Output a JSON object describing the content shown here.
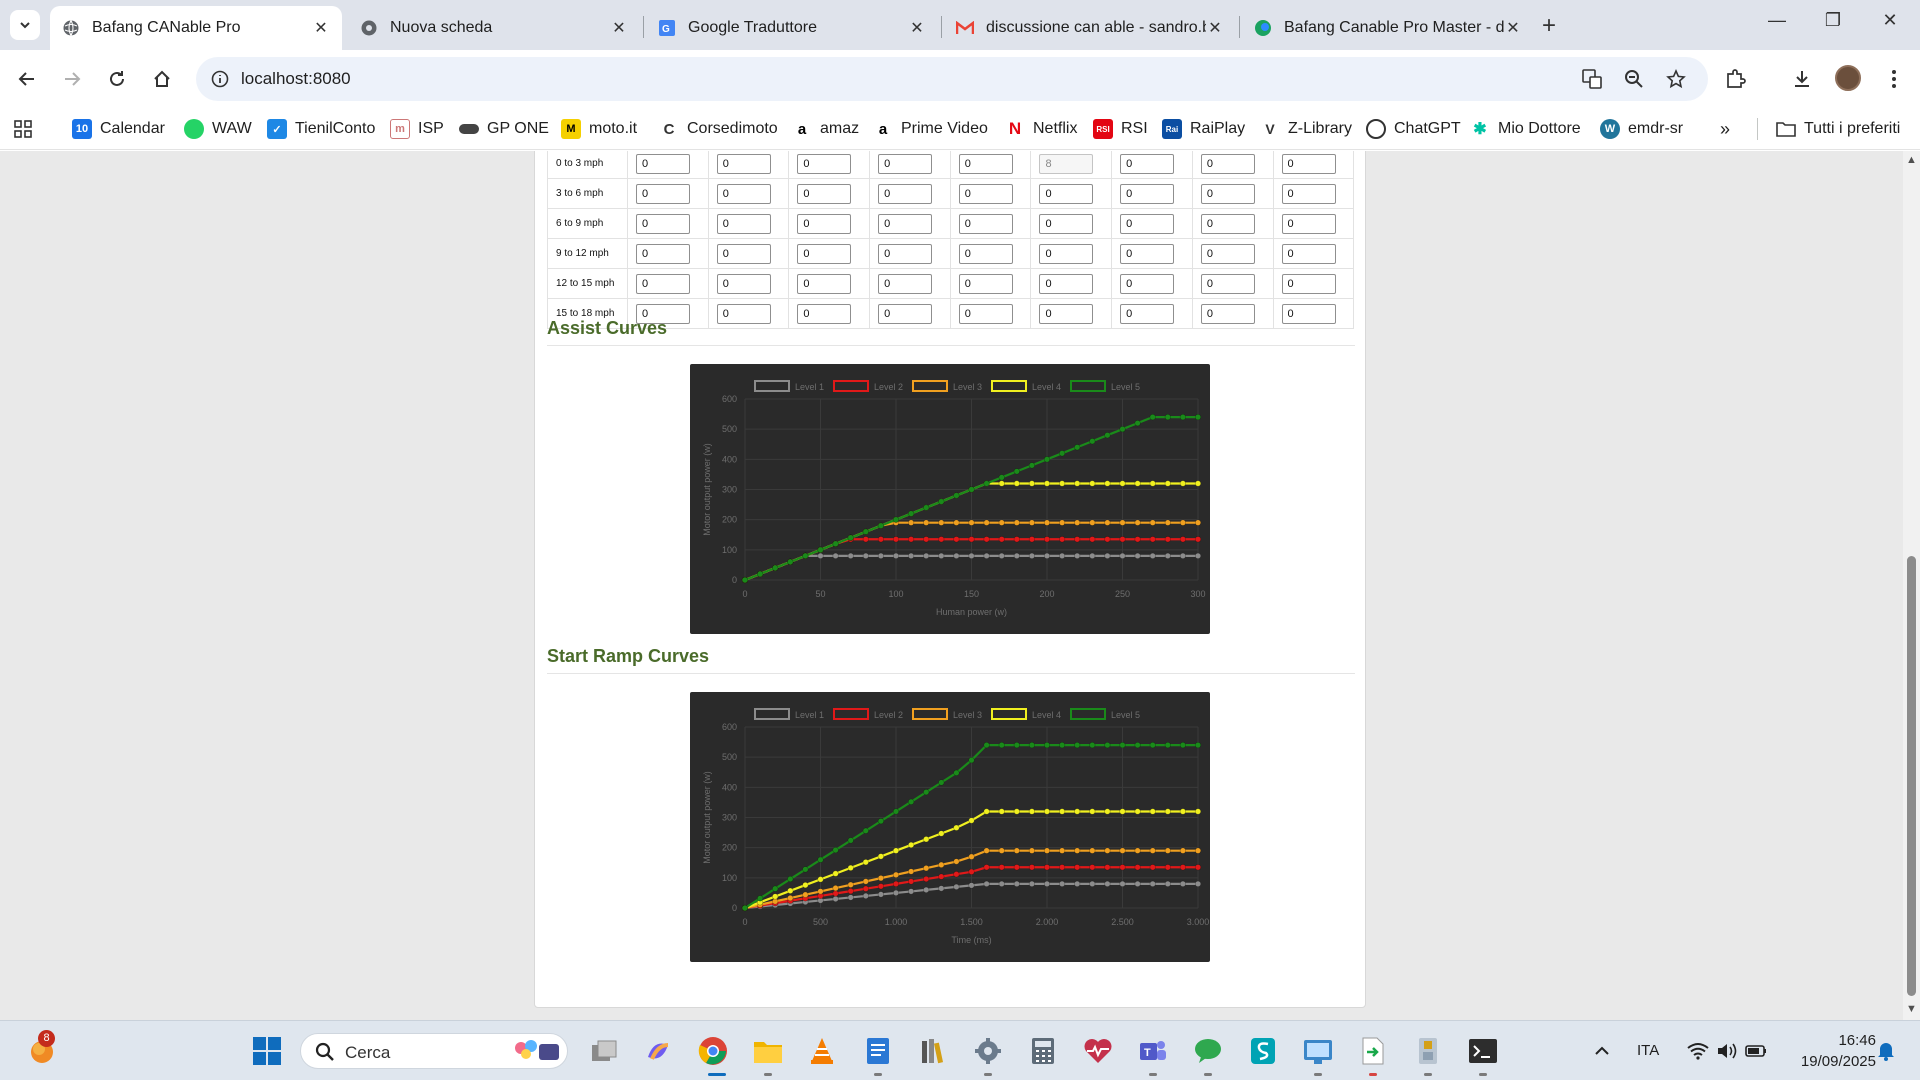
{
  "browser": {
    "tabs": [
      {
        "title": "Bafang CANable Pro",
        "active": true
      },
      {
        "title": "Nuova scheda",
        "active": false
      },
      {
        "title": "Google Traduttore",
        "active": false
      },
      {
        "title": "discussione can able - sandro.b",
        "active": false
      },
      {
        "title": "Bafang Canable Pro Master - di",
        "active": false
      }
    ],
    "url": "localhost:8080",
    "bookmarks": [
      "Calendar",
      "WAW",
      "TienilConto",
      "ISP",
      "GP ONE",
      "moto.it",
      "Corsedimoto",
      "amaz",
      "Prime Video",
      "Netflix",
      "RSI",
      "RaiPlay",
      "Z-Library",
      "ChatGPT",
      "Mio Dottore",
      "emdr-sr"
    ],
    "all_bookmarks": "Tutti i preferiti",
    "calendar_day": "10"
  },
  "table": {
    "rows": [
      {
        "label": "0 to 3 mph",
        "values": [
          "0",
          "0",
          "0",
          "0",
          "0",
          "8",
          "0",
          "0",
          "0"
        ]
      },
      {
        "label": "3 to 6 mph",
        "values": [
          "0",
          "0",
          "0",
          "0",
          "0",
          "0",
          "0",
          "0",
          "0"
        ]
      },
      {
        "label": "6 to 9 mph",
        "values": [
          "0",
          "0",
          "0",
          "0",
          "0",
          "0",
          "0",
          "0",
          "0"
        ]
      },
      {
        "label": "9 to 12 mph",
        "values": [
          "0",
          "0",
          "0",
          "0",
          "0",
          "0",
          "0",
          "0",
          "0"
        ]
      },
      {
        "label": "12 to 15 mph",
        "values": [
          "0",
          "0",
          "0",
          "0",
          "0",
          "0",
          "0",
          "0",
          "0"
        ]
      },
      {
        "label": "15 to 18 mph",
        "values": [
          "0",
          "0",
          "0",
          "0",
          "0",
          "0",
          "0",
          "0",
          "0"
        ]
      }
    ]
  },
  "sections": {
    "assist": "Assist Curves",
    "ramp": "Start Ramp Curves"
  },
  "chart_data": [
    {
      "type": "line",
      "xlabel": "Human power (w)",
      "ylabel": "Motor output power (w)",
      "xlim": [
        0,
        300
      ],
      "ylim": [
        0,
        600
      ],
      "xticks": [
        "0",
        "50",
        "100",
        "150",
        "200",
        "250",
        "300"
      ],
      "yticks": [
        "0",
        "100",
        "200",
        "300",
        "400",
        "500",
        "600"
      ],
      "x": [
        0,
        10,
        20,
        30,
        40,
        50,
        60,
        70,
        80,
        90,
        100,
        110,
        120,
        130,
        140,
        150,
        160,
        170,
        180,
        190,
        200,
        210,
        220,
        230,
        240,
        250,
        260,
        270,
        280,
        290,
        300
      ],
      "legend_position": "top",
      "grid": true,
      "series": [
        {
          "name": "Level 1",
          "color": "#8c8c8c",
          "values": [
            0,
            20,
            40,
            60,
            80,
            80,
            80,
            80,
            80,
            80,
            80,
            80,
            80,
            80,
            80,
            80,
            80,
            80,
            80,
            80,
            80,
            80,
            80,
            80,
            80,
            80,
            80,
            80,
            80,
            80,
            80
          ]
        },
        {
          "name": "Level 2",
          "color": "#e01919",
          "values": [
            0,
            20,
            40,
            60,
            80,
            100,
            120,
            135,
            135,
            135,
            135,
            135,
            135,
            135,
            135,
            135,
            135,
            135,
            135,
            135,
            135,
            135,
            135,
            135,
            135,
            135,
            135,
            135,
            135,
            135,
            135
          ]
        },
        {
          "name": "Level 3",
          "color": "#f0a020",
          "values": [
            0,
            20,
            40,
            60,
            80,
            100,
            120,
            140,
            160,
            180,
            190,
            190,
            190,
            190,
            190,
            190,
            190,
            190,
            190,
            190,
            190,
            190,
            190,
            190,
            190,
            190,
            190,
            190,
            190,
            190,
            190
          ]
        },
        {
          "name": "Level 4",
          "color": "#f0f020",
          "values": [
            0,
            20,
            40,
            60,
            80,
            100,
            120,
            140,
            160,
            180,
            200,
            220,
            240,
            260,
            280,
            300,
            320,
            320,
            320,
            320,
            320,
            320,
            320,
            320,
            320,
            320,
            320,
            320,
            320,
            320,
            320
          ]
        },
        {
          "name": "Level 5",
          "color": "#1a8a1a",
          "values": [
            0,
            20,
            40,
            60,
            80,
            100,
            120,
            140,
            160,
            180,
            200,
            220,
            240,
            260,
            280,
            300,
            320,
            340,
            360,
            380,
            400,
            420,
            440,
            460,
            480,
            500,
            520,
            540,
            540,
            540,
            540
          ]
        }
      ]
    },
    {
      "type": "line",
      "xlabel": "Time (ms)",
      "ylabel": "Motor output power (w)",
      "xlim": [
        0,
        3000
      ],
      "ylim": [
        0,
        600
      ],
      "xticks": [
        "0",
        "500",
        "1.000",
        "1.500",
        "2.000",
        "2.500",
        "3.000"
      ],
      "yticks": [
        "0",
        "100",
        "200",
        "300",
        "400",
        "500",
        "600"
      ],
      "x": [
        0,
        100,
        200,
        300,
        400,
        500,
        600,
        700,
        800,
        900,
        1000,
        1100,
        1200,
        1300,
        1400,
        1500,
        1600,
        1700,
        1800,
        1900,
        2000,
        2100,
        2200,
        2300,
        2400,
        2500,
        2600,
        2700,
        2800,
        2900,
        3000
      ],
      "legend_position": "top",
      "grid": true,
      "series": [
        {
          "name": "Level 1",
          "color": "#8c8c8c",
          "values": [
            0,
            5,
            10,
            15,
            20,
            25,
            30,
            35,
            40,
            45,
            50,
            55,
            60,
            65,
            70,
            75,
            80,
            80,
            80,
            80,
            80,
            80,
            80,
            80,
            80,
            80,
            80,
            80,
            80,
            80,
            80
          ]
        },
        {
          "name": "Level 2",
          "color": "#e01919",
          "values": [
            0,
            8,
            16,
            24,
            32,
            40,
            48,
            56,
            64,
            72,
            80,
            88,
            96,
            104,
            112,
            120,
            135,
            135,
            135,
            135,
            135,
            135,
            135,
            135,
            135,
            135,
            135,
            135,
            135,
            135,
            135
          ]
        },
        {
          "name": "Level 3",
          "color": "#f0a020",
          "values": [
            0,
            11,
            22,
            33,
            44,
            55,
            66,
            77,
            88,
            99,
            110,
            121,
            132,
            143,
            154,
            170,
            190,
            190,
            190,
            190,
            190,
            190,
            190,
            190,
            190,
            190,
            190,
            190,
            190,
            190,
            190
          ]
        },
        {
          "name": "Level 4",
          "color": "#f0f020",
          "values": [
            0,
            19,
            38,
            57,
            76,
            95,
            114,
            133,
            152,
            171,
            190,
            209,
            228,
            247,
            266,
            290,
            320,
            320,
            320,
            320,
            320,
            320,
            320,
            320,
            320,
            320,
            320,
            320,
            320,
            320,
            320
          ]
        },
        {
          "name": "Level 5",
          "color": "#1a8a1a",
          "values": [
            0,
            32,
            64,
            96,
            128,
            160,
            192,
            224,
            256,
            288,
            320,
            352,
            384,
            416,
            448,
            490,
            540,
            540,
            540,
            540,
            540,
            540,
            540,
            540,
            540,
            540,
            540,
            540,
            540,
            540,
            540
          ]
        }
      ]
    }
  ],
  "taskbar": {
    "search": "Cerca",
    "language": "ITA",
    "time": "16:46",
    "date": "19/09/2025",
    "notification_count": "8"
  }
}
